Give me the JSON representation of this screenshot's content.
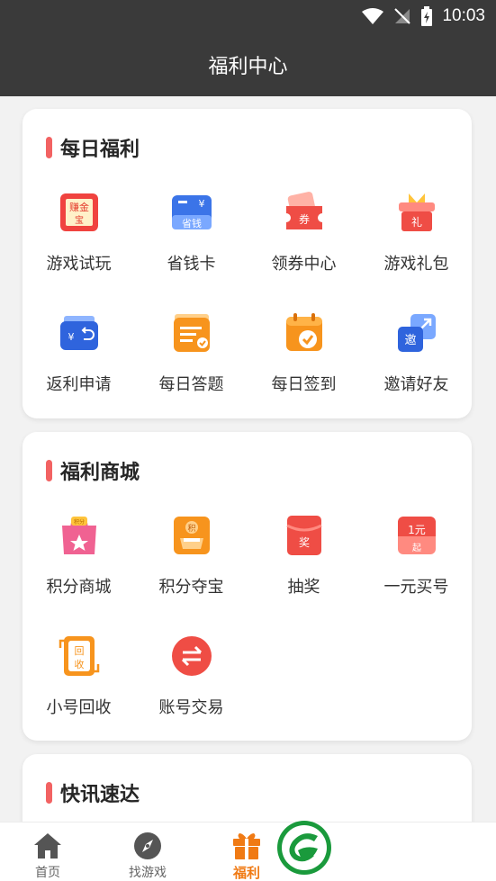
{
  "status": {
    "time": "10:03"
  },
  "header": {
    "title": "福利中心"
  },
  "daily": {
    "title": "每日福利",
    "items": [
      {
        "label": "游戏试玩",
        "icon": "money-bag-icon"
      },
      {
        "label": "省钱卡",
        "icon": "savings-card-icon"
      },
      {
        "label": "领券中心",
        "icon": "coupon-icon"
      },
      {
        "label": "游戏礼包",
        "icon": "gift-pack-icon"
      },
      {
        "label": "返利申请",
        "icon": "rebate-wallet-icon"
      },
      {
        "label": "每日答题",
        "icon": "quiz-clipboard-icon"
      },
      {
        "label": "每日签到",
        "icon": "checkin-calendar-icon"
      },
      {
        "label": "邀请好友",
        "icon": "invite-friend-icon"
      }
    ]
  },
  "mall": {
    "title": "福利商城",
    "items": [
      {
        "label": "积分商城",
        "icon": "points-shop-bag-icon"
      },
      {
        "label": "积分夺宝",
        "icon": "points-treasure-icon"
      },
      {
        "label": "抽奖",
        "icon": "lottery-envelope-icon"
      },
      {
        "label": "一元买号",
        "icon": "one-yuan-account-icon"
      },
      {
        "label": "小号回收",
        "icon": "account-recycle-icon"
      },
      {
        "label": "账号交易",
        "icon": "account-trade-icon"
      }
    ]
  },
  "news": {
    "title": "快讯速达"
  },
  "tabs": [
    {
      "label": "首页",
      "icon": "home-icon"
    },
    {
      "label": "找游戏",
      "icon": "compass-icon"
    },
    {
      "label": "福利",
      "icon": "gift-icon"
    }
  ],
  "icon_text": {
    "earn_top": "赚金",
    "earn_bottom": "宝",
    "yen": "¥",
    "save": "省钱",
    "coupon": "券",
    "gift": "礼",
    "invite": "邀",
    "points": "积分",
    "points_single": "积",
    "prize": "奖",
    "one_yuan": "1元",
    "qi": "起",
    "recycle_top": "回",
    "recycle_bottom": "收"
  },
  "colors": {
    "accent": "#f07a14",
    "bar": "#f26262",
    "header": "#3a3a3a"
  }
}
